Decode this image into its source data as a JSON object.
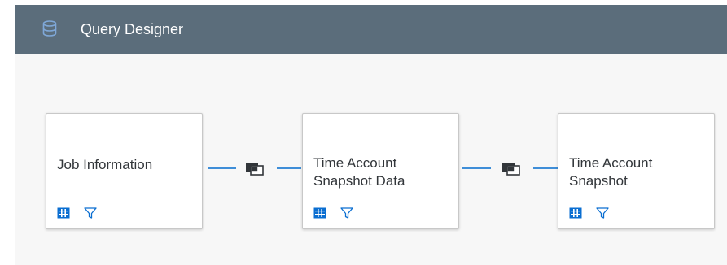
{
  "header": {
    "title": "Query Designer",
    "icon": "database-icon",
    "background": "#5b6d7b"
  },
  "nodes": [
    {
      "label": "Job Information",
      "tools": [
        "columns-icon",
        "filter-icon"
      ]
    },
    {
      "label": "Time Account Snapshot Data",
      "tools": [
        "columns-icon",
        "filter-icon"
      ]
    },
    {
      "label": "Time Account Snapshot",
      "tools": [
        "columns-icon",
        "filter-icon"
      ]
    }
  ],
  "connectors": [
    {
      "icon": "join-icon",
      "color": "#3f8ed8"
    },
    {
      "icon": "join-icon",
      "color": "#3f8ed8"
    }
  ]
}
